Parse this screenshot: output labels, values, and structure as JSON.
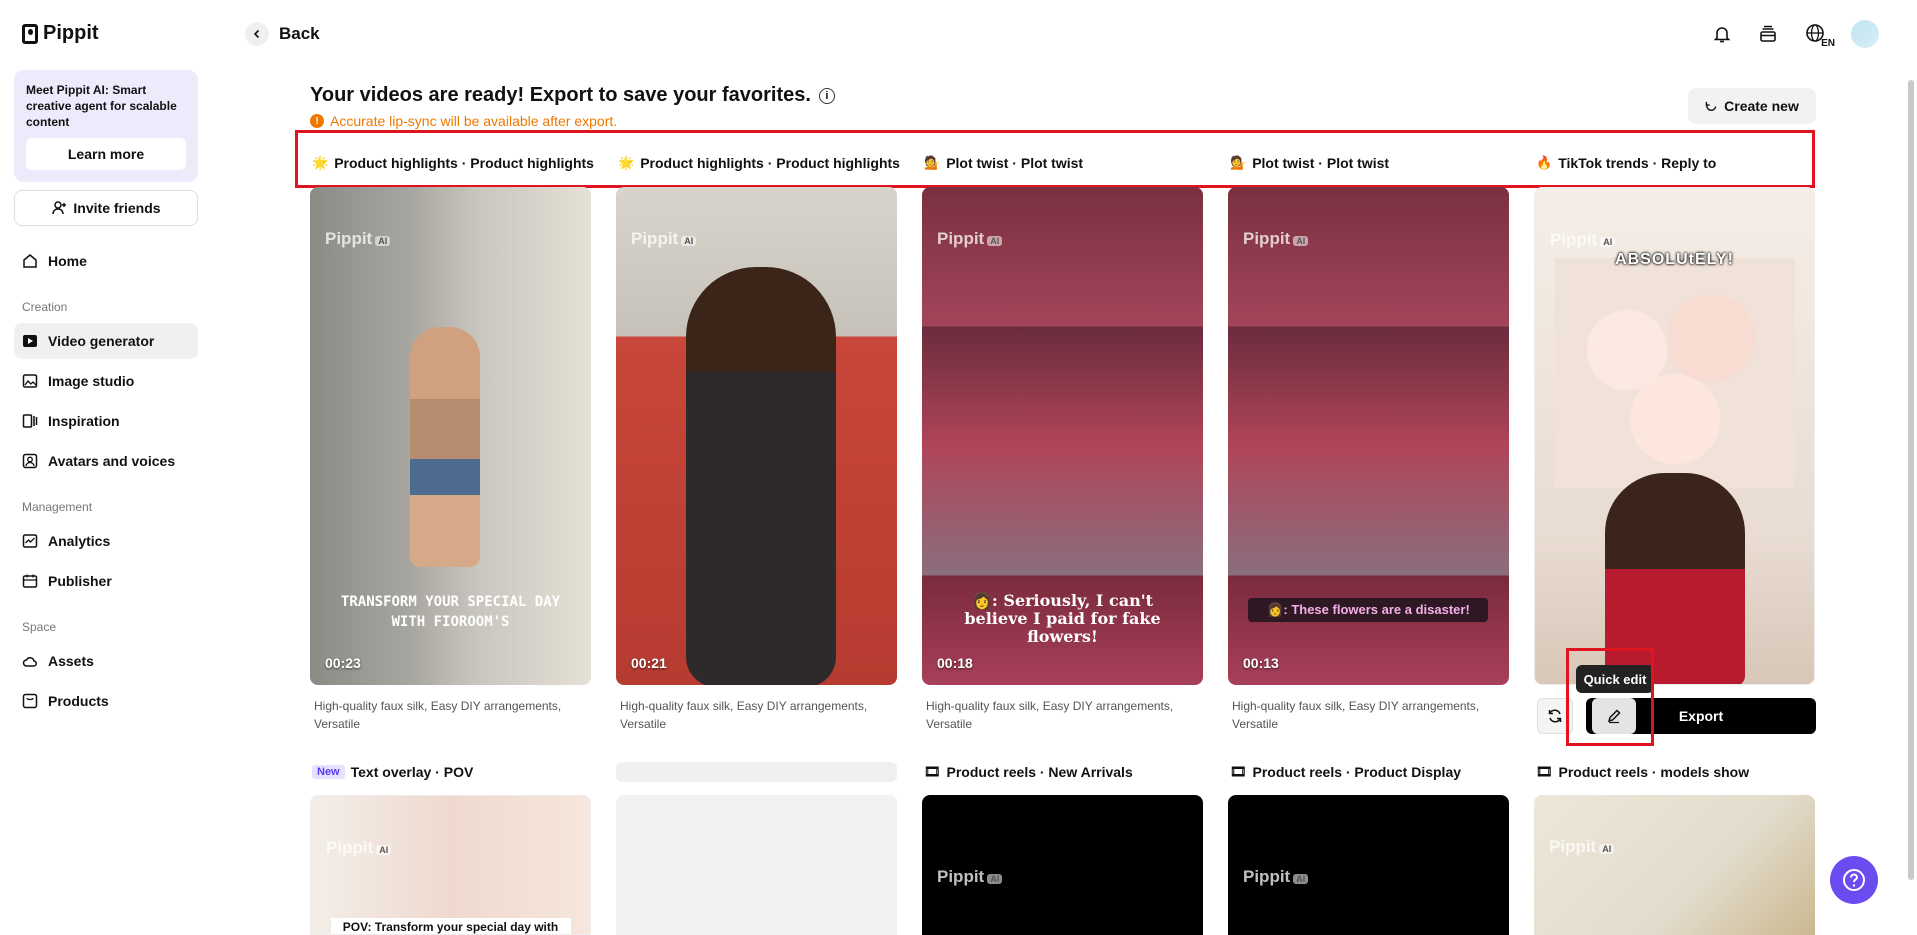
{
  "brand": {
    "name": "Pippit"
  },
  "promo": {
    "text": "Meet Pippit AI: Smart creative agent for scalable content",
    "button": "Learn more"
  },
  "invite": "Invite friends",
  "nav": {
    "home": "Home",
    "creation_label": "Creation",
    "video_generator": "Video generator",
    "image_studio": "Image studio",
    "inspiration": "Inspiration",
    "avatars": "Avatars and voices",
    "management_label": "Management",
    "analytics": "Analytics",
    "publisher": "Publisher",
    "space_label": "Space",
    "assets": "Assets",
    "products": "Products"
  },
  "topbar": {
    "back": "Back",
    "lang": "EN"
  },
  "header": {
    "title": "Your videos are ready! Export to save your favorites.",
    "warning": "Accurate lip-sync will be available after export.",
    "create_new": "Create new"
  },
  "row1": [
    {
      "title": "Product highlights · Product highlights",
      "duration": "00:23",
      "caption": "TRANSFORM YOUR SPECIAL DAY WITH FIOROOM'S",
      "desc": "High-quality faux silk, Easy DIY arrangements, Versatile"
    },
    {
      "title": "Product highlights · Product highlights",
      "duration": "00:21",
      "caption": "",
      "desc": "High-quality faux silk, Easy DIY arrangements, Versatile"
    },
    {
      "title": "Plot twist · Plot twist",
      "duration": "00:18",
      "caption": "👩: Seriously, I can't believe I paid for fake flowers!",
      "desc": "High-quality faux silk, Easy DIY arrangements, Versatile"
    },
    {
      "title": "Plot twist · Plot twist",
      "duration": "00:13",
      "caption": "👩: These flowers are a disaster!",
      "desc": "High-quality faux silk, Easy DIY arrangements, Versatile"
    },
    {
      "title": "TikTok trends · Reply to",
      "duration": "",
      "caption": "ABSOLUtELY!",
      "desc": ""
    }
  ],
  "watermark": "Pippit",
  "watermark_badge": "AI",
  "actions": {
    "export": "Export",
    "quick_edit": "Quick edit"
  },
  "row2": [
    {
      "badge": "New",
      "title": "Text overlay · POV",
      "caption": "POV: Transform your special day with"
    },
    {
      "title": ""
    },
    {
      "title": "Product reels · New Arrivals"
    },
    {
      "title": "Product reels · Product Display"
    },
    {
      "title": "Product reels · models show"
    }
  ],
  "colors": {
    "accent": "#6a4cf0",
    "warning": "#f07800",
    "highlight": "#e0141e"
  }
}
